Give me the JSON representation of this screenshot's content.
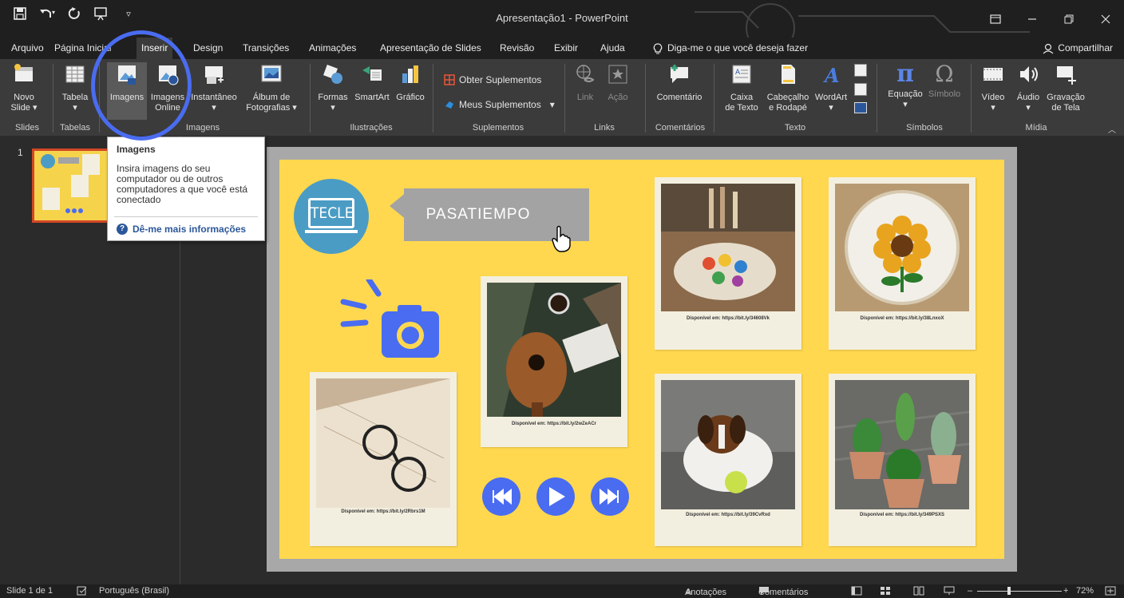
{
  "titlebar": {
    "title": "Apresentação1  -  PowerPoint",
    "qat": [
      "save-icon",
      "undo-icon",
      "redo-icon",
      "present-icon",
      "qat-more-icon"
    ],
    "window_buttons": [
      "ribbon-display-icon",
      "minimize-icon",
      "restore-icon",
      "close-icon"
    ]
  },
  "tabs": {
    "items": [
      "Arquivo",
      "Página Inicial",
      "Inserir",
      "Design",
      "Transições",
      "Animações",
      "Apresentação de Slides",
      "Revisão",
      "Exibir",
      "Ajuda"
    ],
    "active": "Inserir",
    "tell_me": "Diga-me o que você deseja fazer",
    "share": "Compartilhar"
  },
  "ribbon": {
    "novo": [
      "Novo",
      "Slide"
    ],
    "tabela": "Tabela",
    "imagens": "Imagens",
    "imagens_online": [
      "Imagens",
      "Online"
    ],
    "instantaneo": "Instantâneo",
    "album": [
      "Álbum de",
      "Fotografias"
    ],
    "formas": "Formas",
    "smartart": "SmartArt",
    "grafico": "Gráfico",
    "obter": "Obter Suplementos",
    "meus": "Meus Suplementos",
    "link": "Link",
    "acao": "Ação",
    "comentario": "Comentário",
    "caixa": [
      "Caixa",
      "de Texto"
    ],
    "cabecalho": [
      "Cabeçalho",
      "e Rodapé"
    ],
    "wordart": "WordArt",
    "equacao": "Equação",
    "simbolo": "Símbolo",
    "video": "Vídeo",
    "audio": "Áudio",
    "gravacao": [
      "Gravação",
      "de Tela"
    ],
    "groups": {
      "slides": "Slides",
      "tabelas": "Tabelas",
      "imagens": "Imagens",
      "ilustracoes": "Ilustrações",
      "suplementos": "Suplementos",
      "links": "Links",
      "comentarios": "Comentários",
      "texto": "Texto",
      "simbolos": "Símbolos",
      "midia": "Mídia"
    }
  },
  "tooltip": {
    "title": "Imagens",
    "description": "Insira imagens do seu computador ou de outros computadores a que você está conectado",
    "more": "Dê-me mais informações"
  },
  "thumbs": {
    "number": "1"
  },
  "slide": {
    "logo": "TECLE",
    "banner": "PASATIEMPO",
    "captions": {
      "painting": "Disponível em: https://bit.ly/34608Vk",
      "sunflower": "Disponível em: https://bit.ly/38LnxoX",
      "guitar": "Disponível em: https://bit.ly/2wZeACr",
      "glasses": "Disponível em: https://bit.ly/2Rbrs1M",
      "dog": "Disponível em: https://bit.ly/39CvRxd",
      "cactus": "Disponível em: https://bit.ly/349PSXS"
    },
    "colors": {
      "background": "#ffd84f",
      "accent_blue": "#4a6cf0",
      "teal": "#4a9cc4",
      "banner_gray": "#a3a3a3"
    }
  },
  "status": {
    "slide": "Slide 1 de 1",
    "language": "Português (Brasil)",
    "notes": "Anotações",
    "comments": "Comentários",
    "zoom": "72%"
  }
}
